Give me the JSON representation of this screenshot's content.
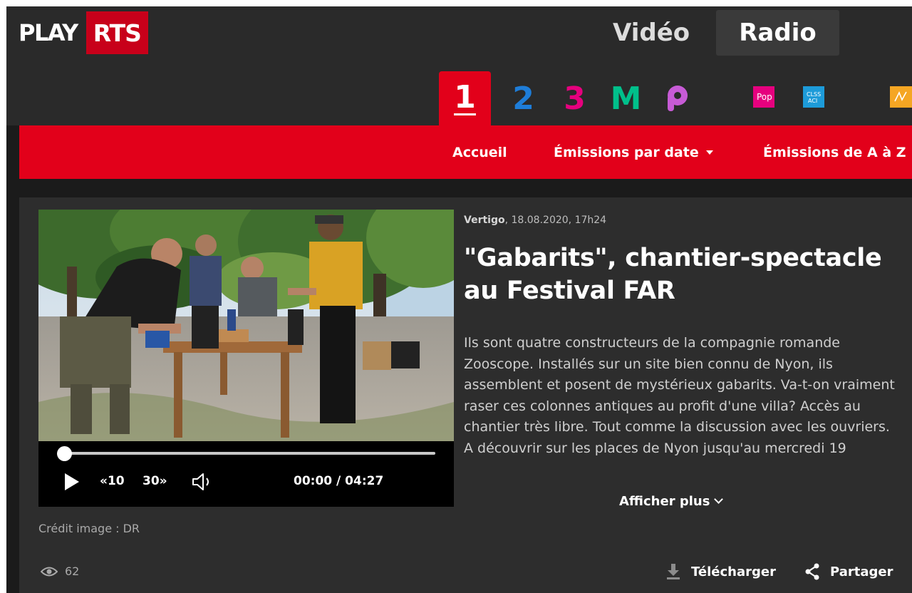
{
  "header": {
    "logo_play": "PLAY",
    "logo_rts": "RTS",
    "nav_video": "Vidéo",
    "nav_radio": "Radio"
  },
  "channels": {
    "items": [
      {
        "label": "1",
        "color": "#e2001a",
        "active": true
      },
      {
        "label": "2",
        "color": "#1e7dd8"
      },
      {
        "label": "3",
        "color": "#e6007e"
      },
      {
        "label": "M",
        "color": "#00c08b"
      },
      {
        "label": "P",
        "color": "#c75bd6"
      },
      {
        "label": "Pop",
        "color": "#e6007e"
      },
      {
        "label": "Classic",
        "color": "#1d9bd9"
      },
      {
        "label": "Jazz",
        "color": "#f5a623"
      }
    ]
  },
  "subnav": {
    "home": "Accueil",
    "by_date": "Émissions par date",
    "a_to_z": "Émissions de A à Z"
  },
  "article": {
    "show": "Vertigo",
    "date": ", 18.08.2020, 17h24",
    "title": "\"Gabarits\", chantier-spectacle au Festival FAR",
    "description": "Ils sont quatre constructeurs de la compagnie romande Zooscope. Installés sur un site bien connu de Nyon, ils assemblent et posent de mystérieux gabarits. Va-t-on vraiment raser ces colonnes antiques au profit d'une villa? Accès au chantier très libre. Tout comme la discussion avec les ouvriers. A découvrir sur les places de Nyon jusqu'au mercredi 19",
    "show_more": "Afficher plus",
    "credit": "Crédit image : DR",
    "views": "62",
    "download": "Télécharger",
    "share": "Partager"
  },
  "player": {
    "skip_back": "«10",
    "skip_forward": "30»",
    "time": "00:00 / 04:27",
    "progress": 0
  },
  "colors": {
    "brand_red": "#e2001a",
    "background": "#1b1b1b",
    "card": "#2d2d2d"
  }
}
